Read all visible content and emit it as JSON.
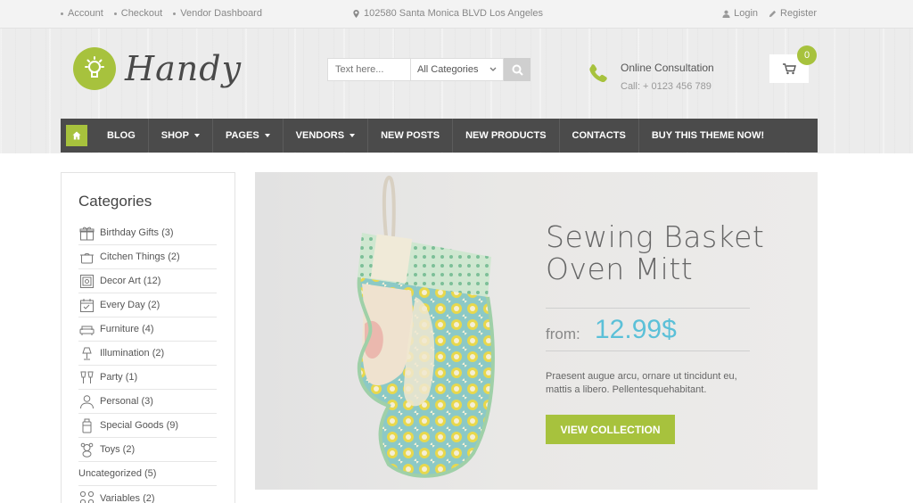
{
  "topbar": {
    "links": [
      "Account",
      "Checkout",
      "Vendor Dashboard"
    ],
    "address": "102580 Santa Monica BLVD Los Angeles",
    "login": "Login",
    "register": "Register"
  },
  "brand": {
    "name": "Handy",
    "accent": "#a7c23d"
  },
  "search": {
    "placeholder": "Text here...",
    "category": "All Categories"
  },
  "consult": {
    "title": "Online Consultation",
    "phone": "Call: + 0123 456 789"
  },
  "cart": {
    "count": "0"
  },
  "nav": {
    "items": [
      {
        "label": "BLOG",
        "dropdown": false
      },
      {
        "label": "SHOP",
        "dropdown": true
      },
      {
        "label": "PAGES",
        "dropdown": true
      },
      {
        "label": "VENDORS",
        "dropdown": true
      },
      {
        "label": "NEW POSTS",
        "dropdown": false
      },
      {
        "label": "NEW PRODUCTS",
        "dropdown": false
      },
      {
        "label": "CONTACTS",
        "dropdown": false
      },
      {
        "label": "BUY THIS THEME NOW!",
        "dropdown": false
      }
    ]
  },
  "sidebar": {
    "title": "Categories",
    "items": [
      {
        "label": "Birthday Gifts (3)",
        "icon": "gift-icon"
      },
      {
        "label": "Citchen Things (2)",
        "icon": "pot-icon"
      },
      {
        "label": "Decor Art (12)",
        "icon": "frame-icon"
      },
      {
        "label": "Every Day (2)",
        "icon": "calendar-icon"
      },
      {
        "label": "Furniture (4)",
        "icon": "sofa-icon"
      },
      {
        "label": "Illumination (2)",
        "icon": "lamp-icon"
      },
      {
        "label": "Party (1)",
        "icon": "glasses-icon"
      },
      {
        "label": "Personal (3)",
        "icon": "person-icon"
      },
      {
        "label": "Special Goods (9)",
        "icon": "bottle-icon"
      },
      {
        "label": "Toys (2)",
        "icon": "teddy-icon"
      },
      {
        "label": "Uncategorized (5)",
        "icon": ""
      },
      {
        "label": "Variables (2)",
        "icon": "dots-icon"
      }
    ]
  },
  "banner": {
    "title_line1": "Sewing Basket",
    "title_line2": "Oven Mitt",
    "from": "from:",
    "price": "12.99$",
    "description": "Praesent augue arcu, ornare ut tincidunt eu, mattis a libero. Pellentesquehabitant.",
    "cta": "VIEW COLLECTION"
  }
}
